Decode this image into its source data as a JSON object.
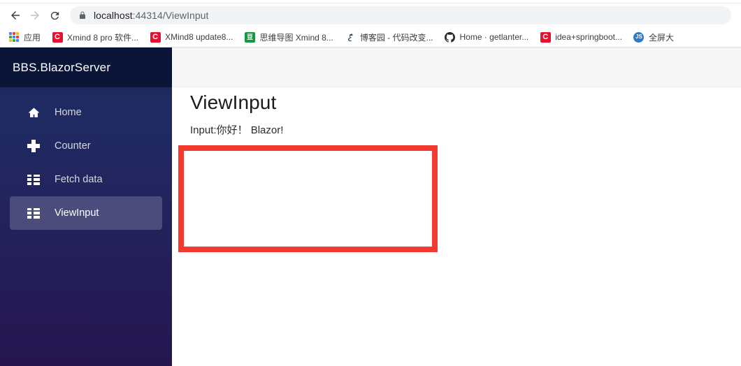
{
  "browser": {
    "back_icon": "arrow-left-icon",
    "forward_icon": "arrow-right-icon",
    "reload_icon": "reload-icon",
    "lock_icon": "lock-icon",
    "url_host": "localhost",
    "url_path": ":44314/ViewInput",
    "url_full": "localhost:44314/ViewInput"
  },
  "bookmarks": {
    "apps_label": "应用",
    "apps_icon": "apps-grid-icon",
    "items": [
      {
        "label": "Xmind 8 pro 软件...",
        "icon": "xmind-icon",
        "glyph": "C",
        "color": "#e8112d",
        "shape": "square"
      },
      {
        "label": "XMind8 update8...",
        "icon": "xmind-icon",
        "glyph": "C",
        "color": "#e8112d",
        "shape": "square"
      },
      {
        "label": "思维导图 Xmind 8...",
        "icon": "xmind-green-icon",
        "glyph": "豆",
        "color": "#1a9641",
        "shape": "square"
      },
      {
        "label": "博客园 - 代码改变...",
        "icon": "cnblogs-icon",
        "glyph": "இ",
        "color": "#2a3f54",
        "shape": "plain"
      },
      {
        "label": "Home · getlanter...",
        "icon": "github-icon",
        "glyph": "",
        "color": "#24292e",
        "shape": "github"
      },
      {
        "label": "idea+springboot...",
        "icon": "xmind-icon",
        "glyph": "C",
        "color": "#e8112d",
        "shape": "square"
      },
      {
        "label": "全屏大",
        "icon": "js-icon",
        "glyph": "JS",
        "color": "#3178c6",
        "shape": "circle"
      }
    ]
  },
  "app": {
    "brand": "BBS.BlazorServer",
    "sidebar": {
      "items": [
        {
          "label": "Home",
          "icon": "home-icon",
          "active": false
        },
        {
          "label": "Counter",
          "icon": "plus-icon",
          "active": false
        },
        {
          "label": "Fetch data",
          "icon": "list-icon",
          "active": false
        },
        {
          "label": "ViewInput",
          "icon": "list-icon",
          "active": true
        }
      ]
    },
    "page": {
      "title": "ViewInput",
      "text": "Input:你好！ Blazor!"
    }
  },
  "annotation": {
    "name": "red-highlight-box",
    "color": "#f23a30",
    "stroke_width": "8px"
  },
  "colors": {
    "sidebar_top": "#1b2a58",
    "sidebar_bottom": "#251650",
    "brand_bar": "#0b1538",
    "active_item": "#4b4b7c",
    "topbar": "#f7f7f7",
    "annotation_red": "#f23a30"
  }
}
